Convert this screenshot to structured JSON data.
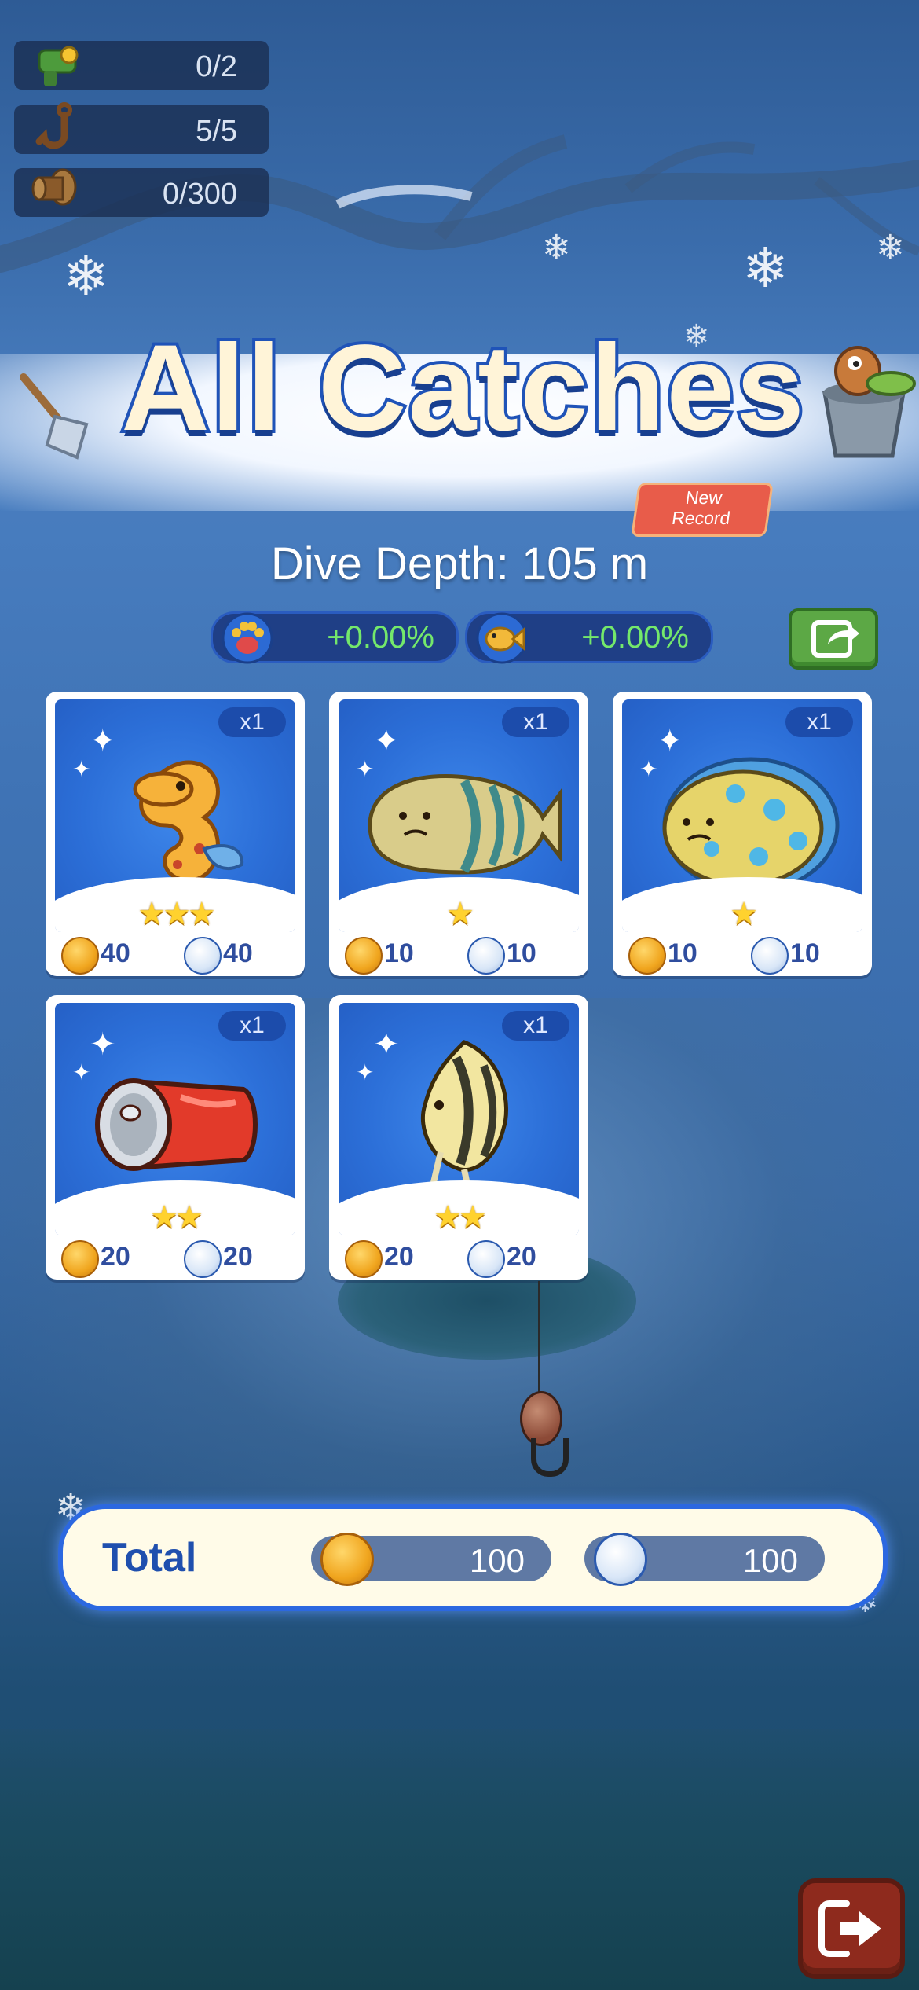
{
  "resources": [
    {
      "icon": "bait-icon",
      "value": "0/2"
    },
    {
      "icon": "hook-icon",
      "value": "5/5"
    },
    {
      "icon": "reel-icon",
      "value": "0/300"
    }
  ],
  "title": "All Catches",
  "badge": {
    "line1": "New",
    "line2": "Record"
  },
  "dive_depth": "Dive Depth: 105 m",
  "bonuses": [
    {
      "icon": "paw-bonus-icon",
      "value": "+0.00%"
    },
    {
      "icon": "fish-bonus-icon",
      "value": "+0.00%"
    }
  ],
  "share_icon": "share-icon",
  "catches": [
    {
      "name": "seahorse",
      "qty": "x1",
      "stars": "★★★",
      "coins": "40",
      "tokens": "40"
    },
    {
      "name": "striped-fish",
      "qty": "x1",
      "stars": "★",
      "coins": "10",
      "tokens": "10"
    },
    {
      "name": "spotted-pufferfish",
      "qty": "x1",
      "stars": "★",
      "coins": "10",
      "tokens": "10"
    },
    {
      "name": "soda-can",
      "qty": "x1",
      "stars": "★★",
      "coins": "20",
      "tokens": "20"
    },
    {
      "name": "angelfish",
      "qty": "x1",
      "stars": "★★",
      "coins": "20",
      "tokens": "20"
    }
  ],
  "total": {
    "label": "Total",
    "coins": "100",
    "tokens": "100"
  },
  "exit_icon": "exit-icon",
  "colors": {
    "title_fill": "#fff4d8",
    "title_stroke": "#1f53b8",
    "bonus_text": "#74e86b",
    "badge": "#e85c4a"
  }
}
